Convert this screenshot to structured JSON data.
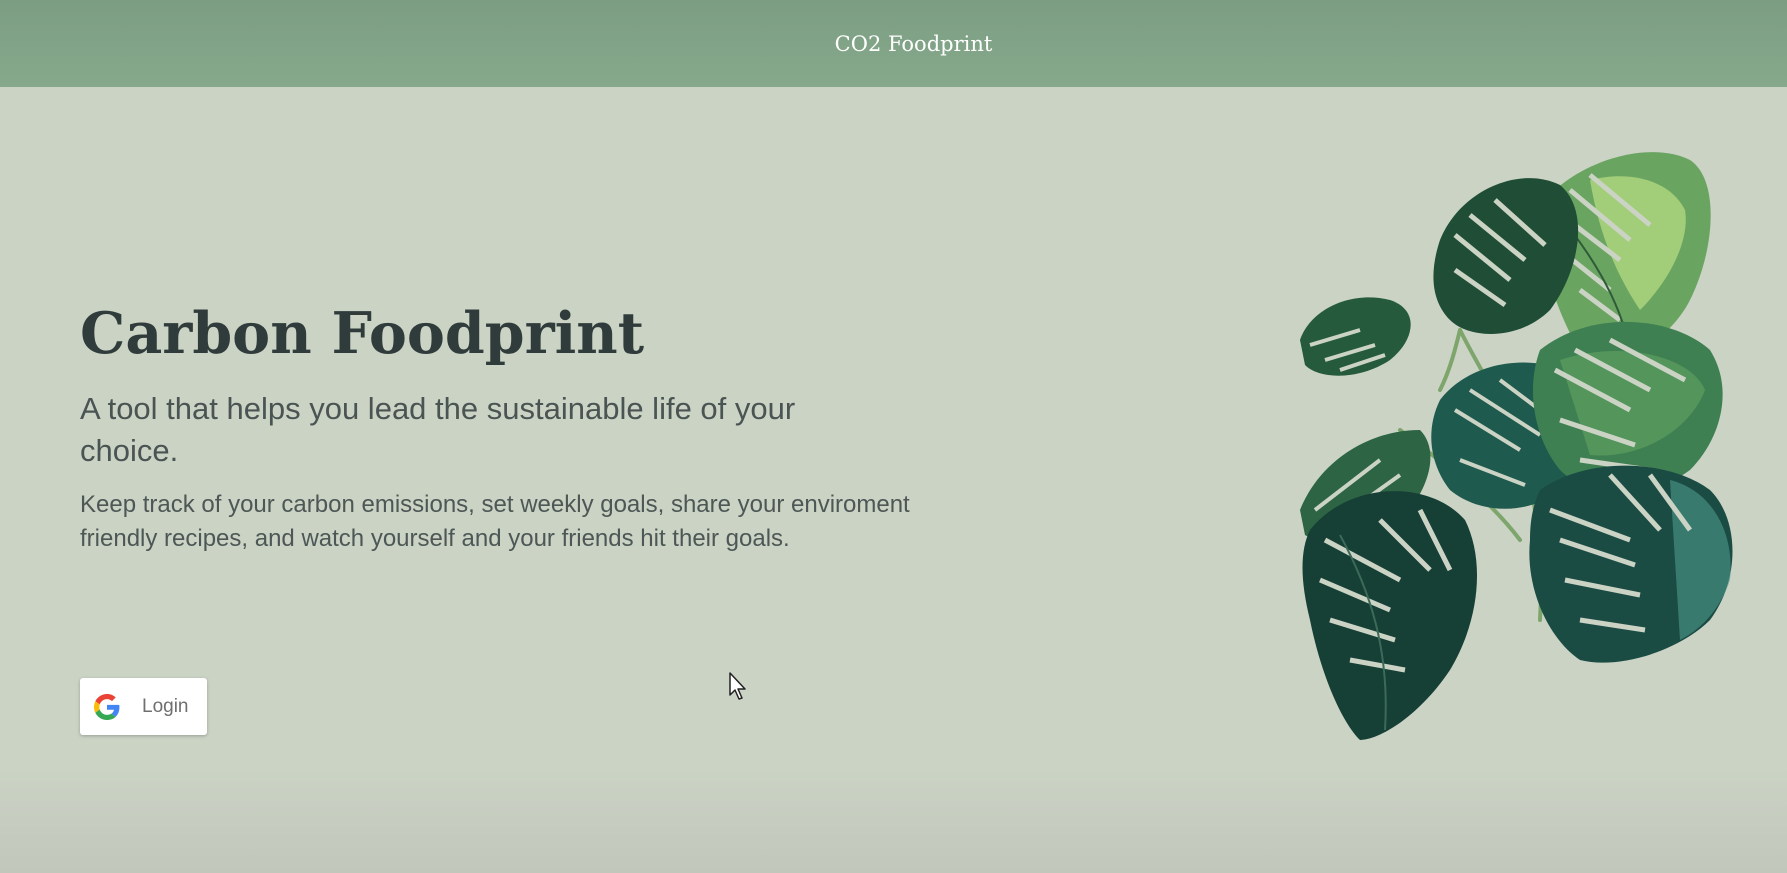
{
  "header": {
    "title": "CO2 Foodprint"
  },
  "hero": {
    "title": "Carbon Foodprint",
    "subtitle": "A tool that helps you lead the sustainable life of your choice.",
    "description": "Keep track of your carbon emissions, set weekly goals, share your enviroment friendly recipes, and watch yourself and your friends hit their goals."
  },
  "login": {
    "label": "Login",
    "icon": "google-icon"
  },
  "illustration": {
    "icon": "monstera-plant-illustration"
  },
  "colors": {
    "header": "#86a98b",
    "background": "#cbd3c5",
    "title": "#303c3b",
    "text": "#4a5452"
  }
}
